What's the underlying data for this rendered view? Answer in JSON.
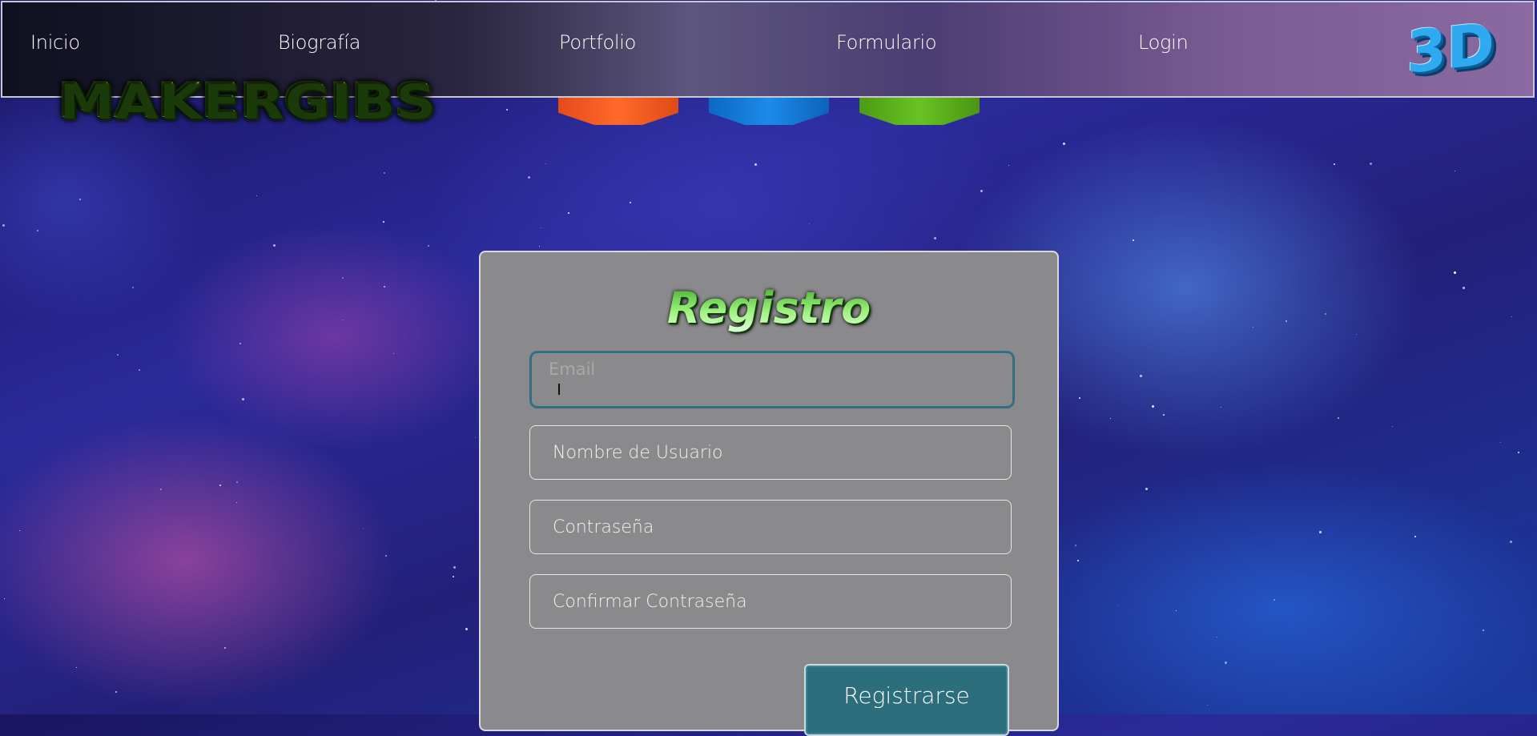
{
  "nav": {
    "items": [
      {
        "label": "Inicio"
      },
      {
        "label": "Biografía"
      },
      {
        "label": "Portfolio"
      },
      {
        "label": "Formulario"
      },
      {
        "label": "Login"
      }
    ],
    "logo_text": "3D"
  },
  "brand": {
    "name": "MAKERGIBS"
  },
  "form": {
    "title": "Registro",
    "email": {
      "label": "Email",
      "value": ""
    },
    "username": {
      "placeholder": "Nombre de Usuario",
      "value": ""
    },
    "password": {
      "placeholder": "Contraseña",
      "value": ""
    },
    "confirm_password": {
      "placeholder": "Confirmar Contraseña",
      "value": ""
    },
    "submit_label": "Registrarse"
  },
  "colors": {
    "brand_green": "#8ff03a",
    "button_teal": "#2d6e7c",
    "card_gray": "#8a898b",
    "focus_border": "#2f7183"
  }
}
